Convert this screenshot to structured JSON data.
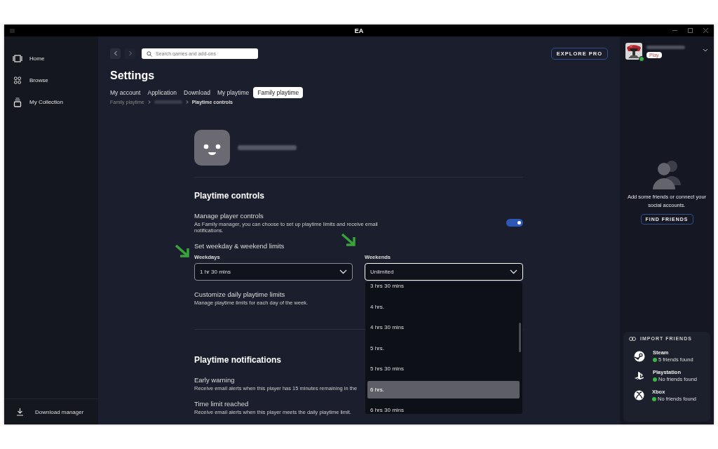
{
  "window": {
    "title": "EA"
  },
  "sidebar": {
    "items": [
      {
        "label": "Home"
      },
      {
        "label": "Browse"
      },
      {
        "label": "My Collection"
      }
    ],
    "footer": "Download manager"
  },
  "topbar": {
    "search": {
      "placeholder": "Search games and add-ons"
    },
    "explore_button": "EXPLORE PRO"
  },
  "profile": {
    "badge": "Play",
    "online": true
  },
  "settings": {
    "title": "Settings",
    "tabs": [
      {
        "label": "My account",
        "selected": false
      },
      {
        "label": "Application",
        "selected": false
      },
      {
        "label": "Download",
        "selected": false
      },
      {
        "label": "My playtime",
        "selected": false
      },
      {
        "label": "Family playtime",
        "selected": true
      }
    ],
    "breadcrumb": [
      "Family playtime",
      "Playtime controls"
    ]
  },
  "controls": {
    "heading": "Playtime controls",
    "manage": {
      "title": "Manage player controls",
      "description": "As Family manager, you can choose to set up playtime limits and receive email notifications.",
      "on": true
    },
    "limits_title": "Set weekday & weekend limits",
    "weekdays": {
      "label": "Weekdays",
      "value": "1 hr 30 mins",
      "expanded": false
    },
    "weekends": {
      "label": "Weekends",
      "value": "Unlimited",
      "expanded": true
    },
    "options": [
      {
        "label": "3 hrs 30 mins",
        "selected": false
      },
      {
        "label": "4 hrs.",
        "selected": false
      },
      {
        "label": "4 hrs 30 mins",
        "selected": false
      },
      {
        "label": "5 hrs.",
        "selected": false
      },
      {
        "label": "5 hrs 30 mins",
        "selected": false
      },
      {
        "label": "6 hrs.",
        "selected": true
      },
      {
        "label": "6 hrs 30 mins",
        "selected": false
      }
    ],
    "customize": {
      "title": "Customize daily playtime limits",
      "description": "Manage playtime limits for each day of the week."
    }
  },
  "notifications": {
    "heading": "Playtime notifications",
    "items": [
      {
        "title": "Early warning",
        "description": "Receive email alerts when this player has 15 minutes remaining in the"
      },
      {
        "title": "Time limit reached",
        "description": "Receive email alerts when this player meets the daily playtime limit."
      }
    ]
  },
  "friends": {
    "message": "Add some friends or connect your social accounts.",
    "button": "FIND FRIENDS",
    "import_title": "IMPORT FRIENDS",
    "accounts": [
      {
        "name": "Steam",
        "status": "5 friends found"
      },
      {
        "name": "Playstation",
        "status": "No friends found"
      },
      {
        "name": "Xbox",
        "status": "No friends found"
      }
    ]
  }
}
